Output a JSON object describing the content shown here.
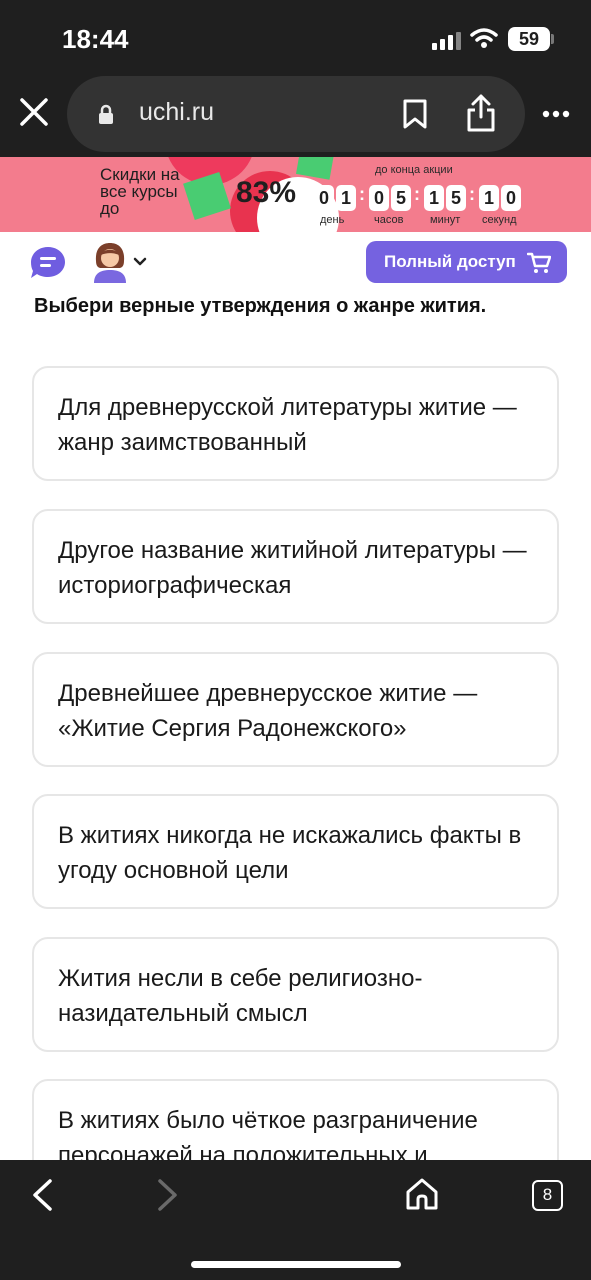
{
  "status_bar": {
    "time": "18:44",
    "battery": "59"
  },
  "browser": {
    "url": "uchi.ru",
    "tab_count": "8"
  },
  "promo": {
    "text": "Скидки на все курсы до",
    "percent": "83%",
    "caption": "до конца акции",
    "digits": [
      "0",
      "1",
      "0",
      "5",
      "1",
      "5",
      "1",
      "0"
    ],
    "units": [
      "день",
      "часов",
      "минут",
      "секунд"
    ]
  },
  "header": {
    "full_access_label": "Полный доступ"
  },
  "question": "Выбери верные утверждения о жанре жития.",
  "options": [
    "Для древнерусской литературы житие — жанр заимствованный",
    "Другое название житийной литературы — историографическая",
    "Древнейшее древнерусское житие — «Житие Сергия Радонежского»",
    "В житиях никогда не искажались факты в угоду основной цели",
    "Жития несли в себе религиозно-назидательный смысл",
    "В житиях было чёткое разграничение персонажей на положительных и"
  ],
  "colors": {
    "accent": "#7562e0",
    "promo_bg": "#f37c8d",
    "chrome": "#1f1f1f"
  }
}
